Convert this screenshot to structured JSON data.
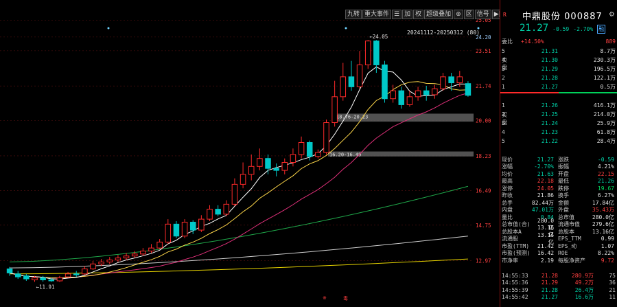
{
  "toolbar": {
    "buttons": [
      "九转",
      "重大事件",
      "☰",
      "加",
      "权",
      "超级叠加",
      "⊕",
      "区",
      "信号",
      "▶|",
      "▾"
    ]
  },
  "chart": {
    "range_label": "20241112-20250312 (80)",
    "right_axis": [
      "25.05",
      "24.20",
      "23.51",
      "21.74",
      "20.00",
      "18.23",
      "16.49",
      "14.75",
      "12.97"
    ],
    "annotations": {
      "high": "←24.05",
      "low": "←11.91",
      "gap1": "18.76-20.23",
      "gap2": "16.20-16.49"
    },
    "bottom_marks": [
      "※",
      "毒"
    ],
    "colors": {
      "up": "#ff2a2a",
      "down": "#00c8c8",
      "ma5": "#ffffff",
      "ma10": "#ffd84a",
      "ma20": "#e0307a",
      "ma60": "#1fa84a",
      "ma120": "#cfcfcf",
      "ma250": "#e6d200"
    }
  },
  "candles": [
    {
      "o": 12.55,
      "c": 12.35,
      "h": 12.65,
      "l": 12.2
    },
    {
      "o": 12.3,
      "c": 12.15,
      "h": 12.45,
      "l": 12.05
    },
    {
      "o": 12.2,
      "c": 12.05,
      "h": 12.3,
      "l": 11.95
    },
    {
      "o": 12.0,
      "c": 12.1,
      "h": 12.2,
      "l": 11.9
    },
    {
      "o": 12.1,
      "c": 12.0,
      "h": 12.2,
      "l": 11.91
    },
    {
      "o": 12.0,
      "c": 11.95,
      "h": 12.1,
      "l": 11.9
    },
    {
      "o": 11.95,
      "c": 12.1,
      "h": 12.2,
      "l": 11.9
    },
    {
      "o": 12.15,
      "c": 12.3,
      "h": 12.4,
      "l": 12.1
    },
    {
      "o": 12.3,
      "c": 12.25,
      "h": 12.45,
      "l": 12.15
    },
    {
      "o": 12.3,
      "c": 12.55,
      "h": 12.7,
      "l": 12.25
    },
    {
      "o": 12.55,
      "c": 12.8,
      "h": 12.95,
      "l": 12.5
    },
    {
      "o": 12.8,
      "c": 12.9,
      "h": 13.05,
      "l": 12.7
    },
    {
      "o": 12.9,
      "c": 13.0,
      "h": 13.15,
      "l": 12.8
    },
    {
      "o": 13.0,
      "c": 13.1,
      "h": 13.25,
      "l": 12.9
    },
    {
      "o": 13.1,
      "c": 13.2,
      "h": 13.35,
      "l": 13.0
    },
    {
      "o": 13.2,
      "c": 13.3,
      "h": 13.45,
      "l": 13.1
    },
    {
      "o": 13.3,
      "c": 13.45,
      "h": 13.6,
      "l": 13.2
    },
    {
      "o": 13.45,
      "c": 13.6,
      "h": 13.8,
      "l": 13.35
    },
    {
      "o": 13.6,
      "c": 13.9,
      "h": 14.05,
      "l": 13.55
    },
    {
      "o": 13.9,
      "c": 14.8,
      "h": 15.05,
      "l": 13.8
    },
    {
      "o": 14.8,
      "c": 14.2,
      "h": 14.95,
      "l": 14.1
    },
    {
      "o": 14.2,
      "c": 14.9,
      "h": 15.05,
      "l": 14.1
    },
    {
      "o": 14.9,
      "c": 14.5,
      "h": 15.0,
      "l": 14.3
    },
    {
      "o": 14.5,
      "c": 15.05,
      "h": 15.25,
      "l": 14.4
    },
    {
      "o": 15.05,
      "c": 15.55,
      "h": 15.75,
      "l": 14.95
    },
    {
      "o": 15.55,
      "c": 15.3,
      "h": 15.75,
      "l": 15.2
    },
    {
      "o": 15.3,
      "c": 15.8,
      "h": 16.0,
      "l": 15.2
    },
    {
      "o": 15.8,
      "c": 16.8,
      "h": 17.1,
      "l": 15.7
    },
    {
      "o": 16.8,
      "c": 17.3,
      "h": 17.9,
      "l": 16.6
    },
    {
      "o": 17.3,
      "c": 17.7,
      "h": 18.3,
      "l": 17.0
    },
    {
      "o": 17.7,
      "c": 18.1,
      "h": 18.6,
      "l": 17.5
    },
    {
      "o": 18.1,
      "c": 17.6,
      "h": 18.3,
      "l": 17.3
    },
    {
      "o": 17.6,
      "c": 17.5,
      "h": 17.85,
      "l": 17.2
    },
    {
      "o": 17.5,
      "c": 17.9,
      "h": 18.1,
      "l": 17.3
    },
    {
      "o": 17.9,
      "c": 18.3,
      "h": 18.6,
      "l": 17.7
    },
    {
      "o": 18.3,
      "c": 18.9,
      "h": 19.2,
      "l": 18.1
    },
    {
      "o": 18.9,
      "c": 18.2,
      "h": 19.0,
      "l": 18.0
    },
    {
      "o": 18.2,
      "c": 18.4,
      "h": 18.55,
      "l": 18.1
    },
    {
      "o": 18.4,
      "c": 19.9,
      "h": 20.05,
      "l": 18.3
    },
    {
      "o": 19.9,
      "c": 21.2,
      "h": 22.0,
      "l": 19.7
    },
    {
      "o": 21.2,
      "c": 22.2,
      "h": 22.9,
      "l": 21.0
    },
    {
      "o": 22.2,
      "c": 21.7,
      "h": 23.0,
      "l": 21.5
    },
    {
      "o": 21.7,
      "c": 22.8,
      "h": 23.5,
      "l": 21.6
    },
    {
      "o": 22.8,
      "c": 24.0,
      "h": 24.05,
      "l": 22.6
    },
    {
      "o": 24.0,
      "c": 22.8,
      "h": 24.05,
      "l": 22.4
    },
    {
      "o": 22.8,
      "c": 21.1,
      "h": 23.0,
      "l": 20.9
    },
    {
      "o": 21.1,
      "c": 21.5,
      "h": 21.8,
      "l": 20.9
    },
    {
      "o": 21.5,
      "c": 20.8,
      "h": 21.7,
      "l": 20.6
    },
    {
      "o": 20.8,
      "c": 21.2,
      "h": 21.5,
      "l": 20.7
    },
    {
      "o": 21.2,
      "c": 21.5,
      "h": 21.7,
      "l": 21.0
    },
    {
      "o": 21.5,
      "c": 21.3,
      "h": 21.75,
      "l": 21.0
    },
    {
      "o": 21.3,
      "c": 21.6,
      "h": 21.8,
      "l": 21.1
    },
    {
      "o": 21.6,
      "c": 22.2,
      "h": 22.4,
      "l": 21.5
    },
    {
      "o": 22.2,
      "c": 21.9,
      "h": 22.4,
      "l": 21.5
    },
    {
      "o": 21.9,
      "c": 22.2,
      "h": 22.5,
      "l": 21.7
    },
    {
      "o": 21.86,
      "c": 21.27,
      "h": 21.98,
      "l": 21.2
    }
  ],
  "side": {
    "r_mark": "R",
    "name": "中鼎股份",
    "code": "000887",
    "price": "21.27",
    "change": "-0.59",
    "change_pct": "-2.70%",
    "fin_badge": "融",
    "ratio": {
      "label": "委比",
      "pct": "+14.50%",
      "diff": "889"
    },
    "sell_caption": "卖盘",
    "buy_caption": "买盘",
    "asks": [
      {
        "lv": "5",
        "p": "21.31",
        "v": "8.7万"
      },
      {
        "lv": "4",
        "p": "21.30",
        "v": "230.3万"
      },
      {
        "lv": "3",
        "p": "21.29",
        "v": "196.5万"
      },
      {
        "lv": "2",
        "p": "21.28",
        "v": "122.1万"
      },
      {
        "lv": "1",
        "p": "21.27",
        "v": "0.5万"
      }
    ],
    "bids": [
      {
        "lv": "1",
        "p": "21.26",
        "v": "416.1万"
      },
      {
        "lv": "2",
        "p": "21.25",
        "v": "214.0万"
      },
      {
        "lv": "3",
        "p": "21.24",
        "v": "25.9万"
      },
      {
        "lv": "4",
        "p": "21.23",
        "v": "61.8万"
      },
      {
        "lv": "5",
        "p": "21.22",
        "v": "28.4万"
      }
    ],
    "stats": [
      {
        "k1": "现价",
        "v1": "21.27",
        "c1": "dn",
        "k2": "涨跌",
        "v2": "-0.59",
        "c2": "dn"
      },
      {
        "k1": "涨幅",
        "v1": "-2.70%",
        "c1": "dn",
        "k2": "振幅",
        "v2": "4.21%",
        "c2": "wh"
      },
      {
        "k1": "均价",
        "v1": "21.63",
        "c1": "dn",
        "k2": "开盘",
        "v2": "22.15",
        "c2": "up"
      },
      {
        "k1": "最高",
        "v1": "22.18",
        "c1": "up",
        "k2": "最低",
        "v2": "21.26",
        "c2": "dn"
      },
      {
        "k1": "涨停",
        "v1": "24.05",
        "c1": "up",
        "k2": "跌停",
        "v2": "19.67",
        "c2": "gn"
      },
      {
        "k1": "昨收",
        "v1": "21.86",
        "c1": "wh",
        "k2": "换手",
        "v2": "6.27%",
        "c2": "wh"
      },
      {
        "k1": "总手",
        "v1": "82.44万",
        "c1": "wh",
        "k2": "金额",
        "v2": "17.84亿",
        "c2": "wh"
      },
      {
        "k1": "内盘",
        "v1": "47.01万",
        "c1": "dn",
        "k2": "外盘",
        "v2": "35.43万",
        "c2": "up"
      },
      {
        "k1": "量比",
        "v1": "0.84",
        "c1": "dn",
        "k2": "总市值",
        "v2": "280.0亿",
        "c2": "wh"
      },
      {
        "k1": "总市值(合)",
        "v1": "280.0亿",
        "c1": "wh",
        "k2": "流通市值",
        "v2": "279.6亿",
        "c2": "wh",
        "wide": true
      },
      {
        "k1": "总股本A",
        "v1": "13.16亿",
        "c1": "wh",
        "k2": "总股本",
        "v2": "13.16亿",
        "c2": "wh",
        "wide": true
      },
      {
        "k1": "流通股",
        "v1": "13.14亿",
        "c1": "wh",
        "k2": "EPS_TTM",
        "v2": "0.99",
        "c2": "wh",
        "wide": true
      },
      {
        "k1": "市盈(TTM)",
        "v1": "21.42",
        "c1": "wh",
        "k2": "EPS_动",
        "v2": "1.07",
        "c2": "wh",
        "wide": true
      },
      {
        "k1": "市盈(预测)",
        "v1": "16.42",
        "c1": "wh",
        "k2": "ROE",
        "v2": "8.22%",
        "c2": "wh",
        "wide": true
      },
      {
        "k1": "市净率",
        "v1": "2.19",
        "c1": "wh",
        "k2": "每股净资产",
        "v2": "9.72",
        "c2": "up",
        "wide": true
      }
    ],
    "ticks": [
      {
        "t": "14:55:33",
        "p": "21.28",
        "v": "280.9万",
        "n": "75",
        "c": "up"
      },
      {
        "t": "14:55:36",
        "p": "21.29",
        "v": "49.2万",
        "n": "36",
        "c": "up"
      },
      {
        "t": "14:55:39",
        "p": "21.28",
        "v": "26.4万",
        "n": "21",
        "c": "dn"
      },
      {
        "t": "14:55:42",
        "p": "21.27",
        "v": "16.6万",
        "n": "11",
        "c": "dn"
      }
    ]
  }
}
